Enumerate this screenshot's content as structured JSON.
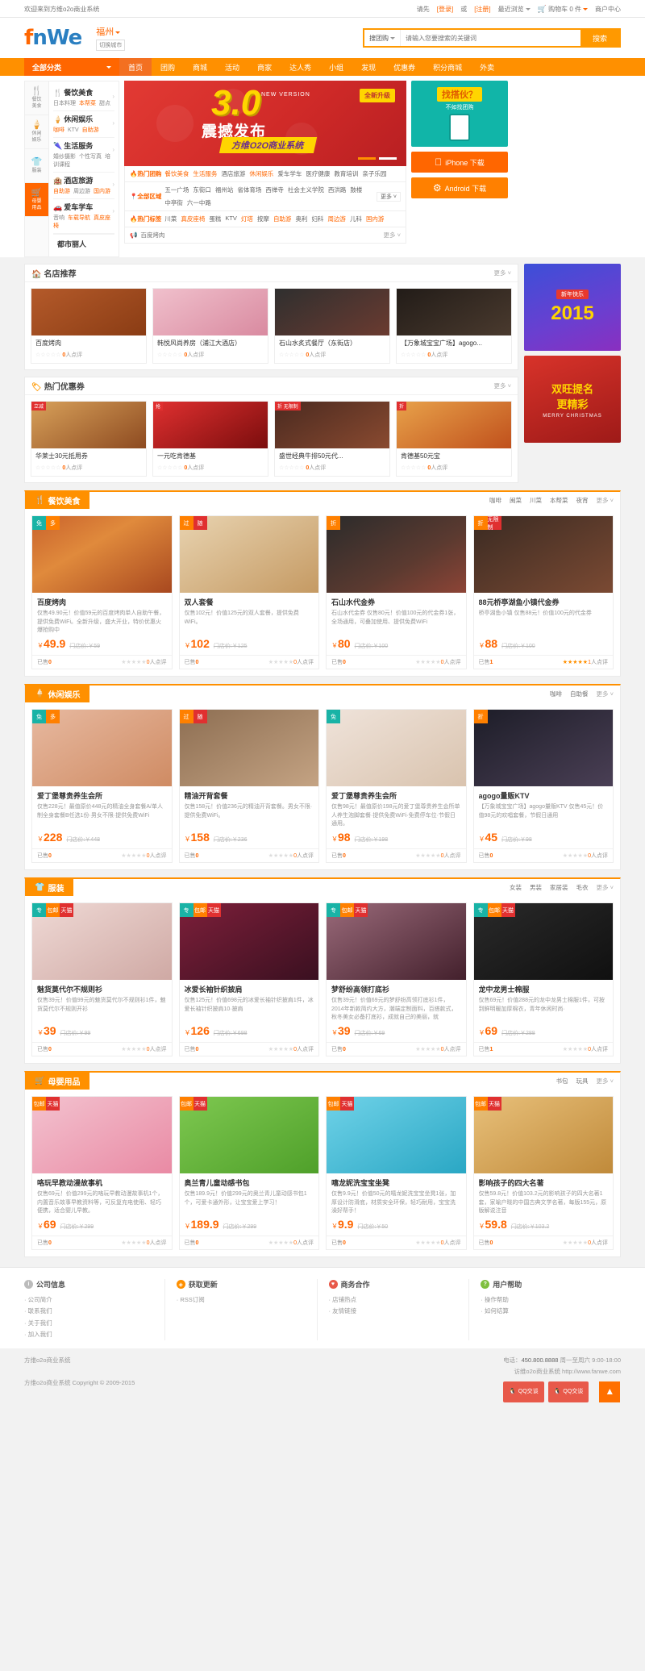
{
  "topbar": {
    "welcome": "欢迎来到方维o2o商业系统",
    "please": "请先",
    "login": "[登录]",
    "or": "或",
    "register": "[注册]",
    "recent": "最近浏览",
    "cart": "购物车 0 件",
    "merchant": "商户中心"
  },
  "header": {
    "logo_a": "f",
    "logo_b": "nWe",
    "city": "福州",
    "switch_city": "切换城市",
    "search_type": "搜团购",
    "search_placeholder": "请输入您要搜索的关键词",
    "search_value": "",
    "search_button": "搜索"
  },
  "nav": {
    "all_categories": "全部分类",
    "items": [
      {
        "label": "首页",
        "active": true
      },
      {
        "label": "团购",
        "active": false
      },
      {
        "label": "商城",
        "active": false
      },
      {
        "label": "活动",
        "active": false
      },
      {
        "label": "商家",
        "active": false
      },
      {
        "label": "达人秀",
        "active": false
      },
      {
        "label": "小组",
        "active": false
      },
      {
        "label": "发现",
        "active": false
      },
      {
        "label": "优惠券",
        "active": false
      },
      {
        "label": "积分商城",
        "active": false
      },
      {
        "label": "外卖",
        "active": false
      }
    ]
  },
  "sidebar": {
    "rail": [
      {
        "icon": "🍴",
        "l1": "餐饮",
        "l2": "美食",
        "on": false
      },
      {
        "icon": "🍦",
        "l1": "休闲",
        "l2": "娱乐",
        "on": false
      },
      {
        "icon": "👕",
        "l1": "服装",
        "l2": "",
        "on": false
      },
      {
        "icon": "🛒",
        "l1": "母婴",
        "l2": "用品",
        "on": true
      }
    ],
    "categories": [
      {
        "icon": "🍴",
        "title": "餐饮美食",
        "subs": [
          {
            "t": "日本料理",
            "hot": false
          },
          {
            "t": "本帮菜",
            "hot": true
          },
          {
            "t": "甜点",
            "hot": false
          }
        ]
      },
      {
        "icon": "🍦",
        "title": "休闲娱乐",
        "subs": [
          {
            "t": "咖啡",
            "hot": true
          },
          {
            "t": "KTV",
            "hot": false
          },
          {
            "t": "自助游",
            "hot": true
          }
        ]
      },
      {
        "icon": "🌂",
        "title": "生活服务",
        "subs": [
          {
            "t": "婚纱摄影",
            "hot": false
          },
          {
            "t": "个性写真",
            "hot": false
          },
          {
            "t": "培训课程",
            "hot": false
          }
        ]
      },
      {
        "icon": "🏨",
        "title": "酒店旅游",
        "subs": [
          {
            "t": "自助游",
            "hot": true
          },
          {
            "t": "周边游",
            "hot": false
          },
          {
            "t": "国内游",
            "hot": true
          }
        ]
      },
      {
        "icon": "🚗",
        "title": "爱车学车",
        "subs": [
          {
            "t": "音响",
            "hot": false
          },
          {
            "t": "车载导航",
            "hot": true
          },
          {
            "t": "真皮座椅",
            "hot": true
          }
        ]
      }
    ],
    "bottom": "都市丽人"
  },
  "banner": {
    "version_num": "3.0",
    "version_label": "NEW VERSION",
    "headline": "震撼发布",
    "ribbon": "方维O2O商业系统",
    "badge": "全新升级"
  },
  "hotsearch": {
    "row1_label": "热门团购",
    "row1_tags": [
      {
        "t": "餐饮美食",
        "hot": true
      },
      {
        "t": "生活服务",
        "hot": true
      },
      {
        "t": "酒店旅游",
        "hot": false
      },
      {
        "t": "休闲娱乐",
        "hot": true
      },
      {
        "t": "爱车学车",
        "hot": false
      },
      {
        "t": "医疗健康",
        "hot": false
      },
      {
        "t": "教育培训",
        "hot": false
      },
      {
        "t": "亲子乐园",
        "hot": false
      }
    ],
    "row2_label": "全部区域",
    "row2_tags": [
      {
        "t": "五一广场",
        "hot": false
      },
      {
        "t": "东街口",
        "hot": false
      },
      {
        "t": "福州站",
        "hot": false
      },
      {
        "t": "省体育场",
        "hot": false
      },
      {
        "t": "西禅寺",
        "hot": false
      },
      {
        "t": "社会主义学院",
        "hot": false
      },
      {
        "t": "西洪路",
        "hot": false
      },
      {
        "t": "鼓楼",
        "hot": false
      },
      {
        "t": "中亭街",
        "hot": false
      },
      {
        "t": "六一中路",
        "hot": false
      }
    ],
    "row2_more": "更多 ˅",
    "row3_label": "热门标签",
    "row3_tags": [
      {
        "t": "川菜",
        "hot": false
      },
      {
        "t": "真皮座椅",
        "hot": true
      },
      {
        "t": "蛋糕",
        "hot": false
      },
      {
        "t": "KTV",
        "hot": false
      },
      {
        "t": "灯塔",
        "hot": true
      },
      {
        "t": "按摩",
        "hot": false
      },
      {
        "t": "自助游",
        "hot": true
      },
      {
        "t": "奥利",
        "hot": false
      },
      {
        "t": "妇科",
        "hot": false
      },
      {
        "t": "周边游",
        "hot": true
      },
      {
        "t": "儿科",
        "hot": false
      },
      {
        "t": "国内游",
        "hot": true
      }
    ],
    "notice_text": "百度烤肉",
    "notice_more": "更多 ˅"
  },
  "promo": {
    "qr_title": "找搭伙？",
    "qr_sub": "不如找团购",
    "iphone": "iPhone 下载",
    "android": "Android 下载"
  },
  "famous": {
    "title": "名店推荐",
    "icon": "🏠",
    "more": "更多 ˅",
    "cards": [
      {
        "name": "百度烤肉",
        "count": "0",
        "suffix": "人点评",
        "img": "ph-p1"
      },
      {
        "name": "韩悦风尚养房（浦江大酒店）",
        "count": "0",
        "suffix": "人点评",
        "img": "ph-p2"
      },
      {
        "name": "石山水炙式餐厅（东街店）",
        "count": "0",
        "suffix": "人点评",
        "img": "ph-p3"
      },
      {
        "name": "【万象城宝宝广场】agogo...",
        "count": "0",
        "suffix": "人点评",
        "img": "ph-p4"
      }
    ]
  },
  "hotdeals": {
    "title": "热门优惠券",
    "icon": "🏷",
    "more": "更多 ˅",
    "cards": [
      {
        "name": "华莱士30元抵用券",
        "count": "0",
        "suffix": "人点评",
        "img": "ph-c1",
        "corner": "立减"
      },
      {
        "name": "一元吃肯德基",
        "count": "0",
        "suffix": "人点评",
        "img": "ph-c2",
        "corner": "抢"
      },
      {
        "name": "盛世经典牛排50元代...",
        "count": "0",
        "suffix": "人点评",
        "img": "ph-c3",
        "corner": "折 无限制"
      },
      {
        "name": "肯德基50元宝",
        "count": "0",
        "suffix": "人点评",
        "img": "ph-c4",
        "corner": "折"
      }
    ]
  },
  "sections": [
    {
      "id": "food",
      "icon": "🍴",
      "title": "餐饮美食",
      "nav": [
        "咖啡",
        "闽菜",
        "川菜",
        "本帮菜",
        "夜宵"
      ],
      "more": "更多 ˅",
      "items": [
        {
          "tags": [
            {
              "t": "免",
              "c": "#19b3a6"
            },
            {
              "t": "多",
              "c": "#ff8000"
            }
          ],
          "img": "ph-food1",
          "title": "百度烤肉",
          "desc": "仅售49.90元！价值59元的百度烤肉单人自助午餐，提供免费WiFi。全新升级，盛大开业，特价优惠火爆抢购中",
          "price": "49.9",
          "old": "￥59",
          "sold_label": "已售",
          "sold": "0",
          "stars_on": 0,
          "review_count": "0",
          "review_suffix": "人点评"
        },
        {
          "tags": [
            {
              "t": "过",
              "c": "#ff8000"
            },
            {
              "t": "随",
              "c": "#e03030"
            }
          ],
          "img": "ph-food2",
          "title": "双人套餐",
          "desc": "仅售102元！价值125元的双人套餐，提供免费WiFi。",
          "price": "102",
          "old": "￥125",
          "sold_label": "已售",
          "sold": "0",
          "stars_on": 0,
          "review_count": "0",
          "review_suffix": "人点评"
        },
        {
          "tags": [
            {
              "t": "折",
              "c": "#ff8000"
            }
          ],
          "img": "ph-food3",
          "title": "石山水代金券",
          "desc": "石山水代金券 仅售80元！价值100元的代金券1张，全场通用，可叠加使用、提供免费WiFi",
          "price": "80",
          "old": "￥100",
          "sold_label": "已售",
          "sold": "0",
          "stars_on": 0,
          "review_count": "0",
          "review_suffix": "人点评"
        },
        {
          "tags": [
            {
              "t": "折",
              "c": "#ff8000"
            },
            {
              "t": "无限制",
              "c": "#e03030"
            }
          ],
          "img": "ph-food4",
          "title": "88元桥亭湖鱼小镇代金券",
          "desc": "桥亭湖鱼小镇 仅售88元！价值100元的代金券",
          "price": "88",
          "old": "￥100",
          "sold_label": "已售",
          "sold": "1",
          "stars_on": 5,
          "review_count": "1",
          "review_suffix": "人点评"
        }
      ]
    },
    {
      "id": "leisure",
      "icon": "🍦",
      "title": "休闲娱乐",
      "nav": [
        "咖啡",
        "自助餐"
      ],
      "more": "更多 ˅",
      "items": [
        {
          "tags": [
            {
              "t": "免",
              "c": "#19b3a6"
            },
            {
              "t": "多",
              "c": "#ff8000"
            }
          ],
          "img": "ph-spa1",
          "title": "爱丁堡尊贵养生会所",
          "desc": "仅售228元！最值原价448元的精油全身套餐A/单人制全身套餐B任选1份·男女不限·提供免费WiFi",
          "price": "228",
          "old": "￥448",
          "sold_label": "已售",
          "sold": "0",
          "stars_on": 0,
          "review_count": "0",
          "review_suffix": "人点评"
        },
        {
          "tags": [
            {
              "t": "过",
              "c": "#ff8000"
            },
            {
              "t": "随",
              "c": "#e03030"
            }
          ],
          "img": "ph-spa2",
          "title": "精油开背套餐",
          "desc": "仅售158元！价值236元的精油开背套餐。男女不限·提供免费WiFi。",
          "price": "158",
          "old": "￥236",
          "sold_label": "已售",
          "sold": "0",
          "stars_on": 0,
          "review_count": "0",
          "review_suffix": "人点评"
        },
        {
          "tags": [
            {
              "t": "免",
              "c": "#19b3a6"
            }
          ],
          "img": "ph-spa3",
          "title": "爱丁堡尊贵养生会所",
          "desc": "仅售98元！最值原价198元的爱丁堡尊贵养生会所单人养生泡脚套餐·提供免费WiFi·免费停车位·节假日通用。",
          "price": "98",
          "old": "￥198",
          "sold_label": "已售",
          "sold": "0",
          "stars_on": 0,
          "review_count": "0",
          "review_suffix": "人点评"
        },
        {
          "tags": [
            {
              "t": "折",
              "c": "#ff8000"
            }
          ],
          "img": "ph-spa4",
          "title": "agogo量贩KTV",
          "desc": "【万象城宝宝广场】agogo量贩KTV 仅售45元！价值98元的欢唱套餐，节假日通用",
          "price": "45",
          "old": "￥98",
          "sold_label": "已售",
          "sold": "0",
          "stars_on": 0,
          "review_count": "0",
          "review_suffix": "人点评"
        }
      ]
    },
    {
      "id": "clothing",
      "icon": "👕",
      "title": "服装",
      "nav": [
        "女装",
        "男装",
        "家居装",
        "毛衣"
      ],
      "more": "更多 ˅",
      "items": [
        {
          "tags": [
            {
              "t": "专",
              "c": "#19b3a6"
            },
            {
              "t": "包邮",
              "c": "#ff8000"
            },
            {
              "t": "天猫",
              "c": "#e03030"
            }
          ],
          "img": "ph-cl1",
          "title": "魅货莫代尔不规则衫",
          "desc": "仅售39元！价值99元的魅货莫代尔不规则衫1件，魅货莫代尔不规则开衫",
          "price": "39",
          "old": "￥99",
          "sold_label": "已售",
          "sold": "0",
          "stars_on": 0,
          "review_count": "0",
          "review_suffix": "人点评"
        },
        {
          "tags": [
            {
              "t": "专",
              "c": "#19b3a6"
            },
            {
              "t": "包邮",
              "c": "#ff8000"
            },
            {
              "t": "天猫",
              "c": "#e03030"
            }
          ],
          "img": "ph-cl2",
          "title": "冰爱长袖针织披肩",
          "desc": "仅售125元！价值698元的冰爱长袖针织披肩1件，冰爱长袖针织披肩10·披肩",
          "price": "126",
          "old": "￥698",
          "sold_label": "已售",
          "sold": "0",
          "stars_on": 0,
          "review_count": "0",
          "review_suffix": "人点评"
        },
        {
          "tags": [
            {
              "t": "专",
              "c": "#19b3a6"
            },
            {
              "t": "包邮",
              "c": "#ff8000"
            },
            {
              "t": "天猫",
              "c": "#e03030"
            }
          ],
          "img": "ph-cl3",
          "title": "梦舒纷高领打底衫",
          "desc": "仅售39元！价值69元的梦舒纷高领打底衫1件，2014年新款简约大方，潮端定制面料，百搭款式，秋冬美女必备打底衫，成就自己的美丽，就",
          "price": "39",
          "old": "￥69",
          "sold_label": "已售",
          "sold": "0",
          "stars_on": 0,
          "review_count": "0",
          "review_suffix": "人点评"
        },
        {
          "tags": [
            {
              "t": "专",
              "c": "#19b3a6"
            },
            {
              "t": "包邮",
              "c": "#ff8000"
            },
            {
              "t": "天猫",
              "c": "#e03030"
            }
          ],
          "img": "ph-cl4",
          "title": "龙中龙男士棉服",
          "desc": "仅售69元！价值288元的龙中龙男士棉服1件，可按到鲜明暖加厚棉衣，青年休闲时尚·",
          "price": "69",
          "old": "￥288",
          "sold_label": "已售",
          "sold": "1",
          "stars_on": 0,
          "review_count": "0",
          "review_suffix": "人点评"
        }
      ]
    },
    {
      "id": "baby",
      "icon": "🛒",
      "title": "母婴用品",
      "nav": [
        "书包",
        "玩具"
      ],
      "more": "更多 ˅",
      "items": [
        {
          "tags": [
            {
              "t": "包邮",
              "c": "#ff8000"
            },
            {
              "t": "天猫",
              "c": "#e03030"
            }
          ],
          "img": "ph-kid1",
          "title": "咯玩早教动漫故事机",
          "desc": "仅售69元！价值299元的咯玩早教动漫故事机1个，内置音乐故事早教资料等，可反复充电使用、轻巧便携，适合婴儿早教。",
          "price": "69",
          "old": "￥299",
          "sold_label": "已售",
          "sold": "0",
          "stars_on": 0,
          "review_count": "0",
          "review_suffix": "人点评"
        },
        {
          "tags": [
            {
              "t": "包邮",
              "c": "#ff8000"
            },
            {
              "t": "天猫",
              "c": "#e03030"
            }
          ],
          "img": "ph-kid2",
          "title": "奥兰青儿童动感书包",
          "desc": "仅售189.9元！价值299元的奥兰青儿童动感书包1个，可爱卡通外形，让宝宝爱上学习！",
          "price": "189.9",
          "old": "￥299",
          "sold_label": "已售",
          "sold": "0",
          "stars_on": 0,
          "review_count": "0",
          "review_suffix": "人点评"
        },
        {
          "tags": [
            {
              "t": "包邮",
              "c": "#ff8000"
            },
            {
              "t": "天猫",
              "c": "#e03030"
            }
          ],
          "img": "ph-kid3",
          "title": "嘻龙妮洗宝宝坐凳",
          "desc": "仅售9.9元！价值50元的嘻龙妮洗宝宝坐凳1张，加厚设计防滑底，材质安全环保，轻巧耐用，宝宝洗澡好帮手！",
          "price": "9.9",
          "old": "￥50",
          "sold_label": "已售",
          "sold": "0",
          "stars_on": 0,
          "review_count": "0",
          "review_suffix": "人点评"
        },
        {
          "tags": [
            {
              "t": "包邮",
              "c": "#ff8000"
            },
            {
              "t": "天猫",
              "c": "#e03030"
            }
          ],
          "img": "ph-kid4",
          "title": "影响孩子的四大名著",
          "desc": "仅售59.8元！价值103.2元的影响孩子的四大名著1套，家喻户晓的中国古典文学名著，每版155元，原版解说注音",
          "price": "59.8",
          "old": "￥103.2",
          "sold_label": "已售",
          "sold": "0",
          "stars_on": 0,
          "review_count": "0",
          "review_suffix": "人点评"
        }
      ]
    }
  ],
  "ads": {
    "newyear_year": "2015",
    "newyear_top": "新年快乐",
    "xmas_title": "双旺提名",
    "xmas_title2": "更精彩",
    "xmas_sub": "MERRY CHRISTMAS"
  },
  "footer": {
    "columns": [
      {
        "badge": "i",
        "badge_class": "b",
        "title": "公司信息",
        "links": [
          "公司简介",
          "联系我们",
          "关于我们",
          "加入我们"
        ]
      },
      {
        "badge": "◈",
        "badge_class": "b o",
        "title": "获取更新",
        "links": [
          "RSS订阅"
        ]
      },
      {
        "badge": "♥",
        "badge_class": "b r",
        "title": "商务合作",
        "links": [
          "店铺热点",
          "友情链接"
        ]
      },
      {
        "badge": "?",
        "badge_class": "b g",
        "title": "用户帮助",
        "links": [
          "操作帮助",
          "如何结算"
        ]
      }
    ],
    "copyright_brand": "方维o2o商业系统",
    "copyright_line": "方维o2o商业系统 Copyright © 2009-2015",
    "tel_label": "电话：",
    "tel": "450.800.8888",
    "hours": "周一至周六 9:00-18:00",
    "site_label": "访维o2o商业系统",
    "site_url": "http://www.fanwe.com",
    "qq1": "QQ交谈",
    "qq2": "QQ交谈",
    "gotop": "▲"
  }
}
